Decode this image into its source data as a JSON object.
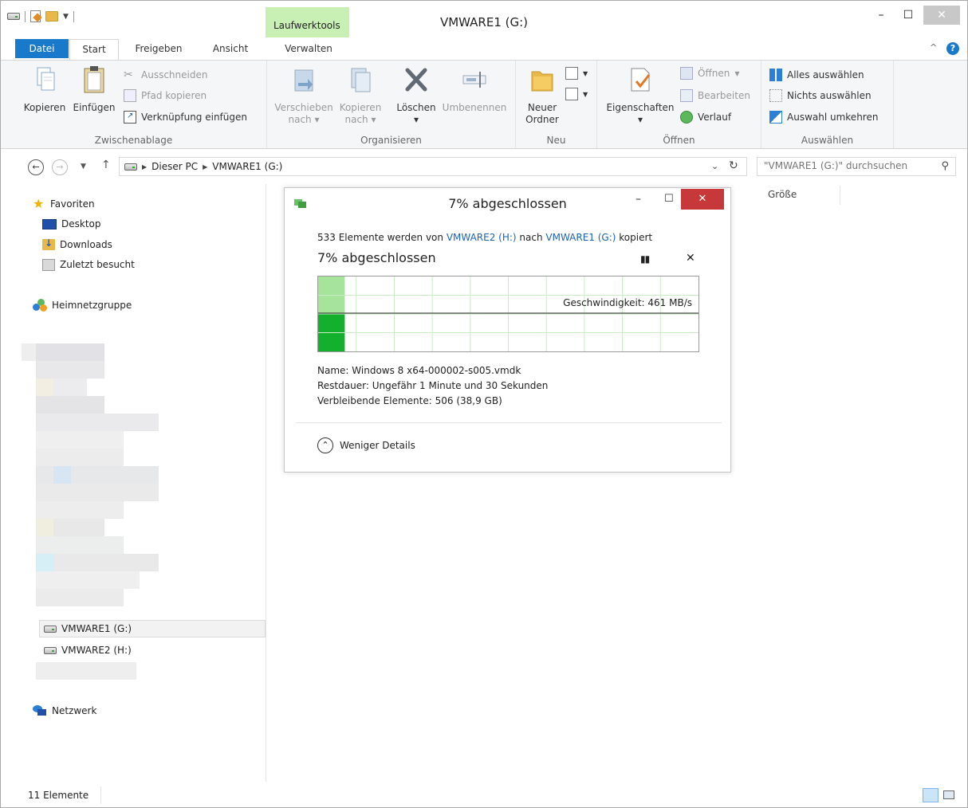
{
  "window": {
    "title": "VMWARE1 (G:)",
    "context_tab": "Laufwerktools"
  },
  "ribbon_tabs": [
    "Datei",
    "Start",
    "Freigeben",
    "Ansicht",
    "Verwalten"
  ],
  "ribbon": {
    "clipboard": {
      "label": "Zwischenablage",
      "copy": "Kopieren",
      "paste": "Einfügen",
      "cut": "Ausschneiden",
      "copy_path": "Pfad kopieren",
      "paste_shortcut": "Verknüpfung einfügen"
    },
    "organize": {
      "label": "Organisieren",
      "move_line1": "Verschieben",
      "move_line2": "nach",
      "copyto_line1": "Kopieren",
      "copyto_line2": "nach",
      "delete": "Löschen",
      "rename": "Umbenennen"
    },
    "new": {
      "label": "Neu",
      "folder_line1": "Neuer",
      "folder_line2": "Ordner"
    },
    "open": {
      "label": "Öffnen",
      "properties": "Eigenschaften",
      "open": "Öffnen",
      "edit": "Bearbeiten",
      "history": "Verlauf"
    },
    "select": {
      "label": "Auswählen",
      "select_all": "Alles auswählen",
      "select_none": "Nichts auswählen",
      "invert": "Auswahl umkehren"
    }
  },
  "address": {
    "crumbs": [
      "Dieser PC",
      "VMWARE1 (G:)"
    ],
    "search_placeholder": "\"VMWARE1 (G:)\" durchsuchen"
  },
  "nav": {
    "favorites": "Favoriten",
    "desktop": "Desktop",
    "downloads": "Downloads",
    "recent": "Zuletzt besucht",
    "homegroup": "Heimnetzgruppe",
    "drive_g": "VMWARE1 (G:)",
    "drive_h": "VMWARE2 (H:)",
    "network": "Netzwerk"
  },
  "content": {
    "column_size": "Größe"
  },
  "status": {
    "count": "11 Elemente"
  },
  "dialog": {
    "title": "7% abgeschlossen",
    "line_prefix": "533 Elemente werden von ",
    "source": "VMWARE2 (H:)",
    "line_mid": " nach ",
    "target": "VMWARE1 (G:)",
    "line_suffix": " kopiert",
    "status": "7% abgeschlossen",
    "speed": "Geschwindigkeit: 461 MB/s",
    "progress_fraction": 0.07,
    "details": {
      "name_label": "Name:",
      "name_value": "Windows 8 x64-000002-s005.vmdk",
      "time_label": "Restdauer:",
      "time_value": "Ungefähr 1 Minute und 30 Sekunden",
      "remaining_label": "Verbleibende Elemente:",
      "remaining_value": "506 (38,9 GB)"
    },
    "less_details": "Weniger Details"
  },
  "colors": {
    "accent": "#1979ca",
    "context_tab": "#c9f0b4",
    "progress_fill": "#12b02c",
    "progress_done": "#a6e39b",
    "close_red": "#c7383a",
    "link": "#1a62b8"
  }
}
